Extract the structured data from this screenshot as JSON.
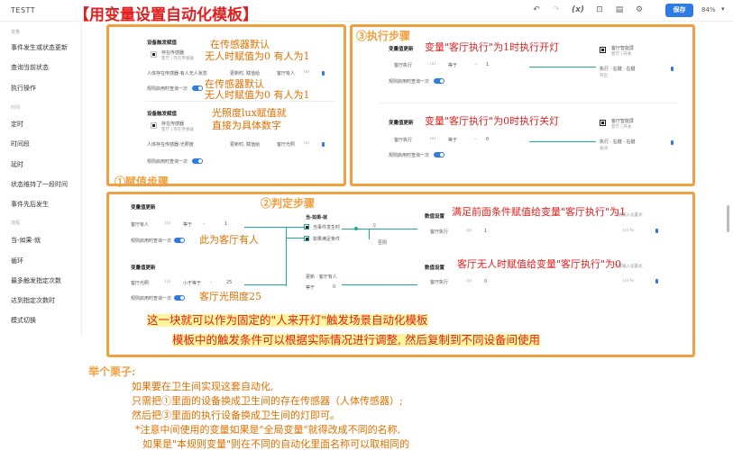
{
  "app": {
    "title": "TESTT",
    "main_title": "【用变量设置自动化模板】"
  },
  "toolbar": {
    "save_label": "保存",
    "zoom": "84%",
    "fx_label": "(x)"
  },
  "sidebar": {
    "sections": [
      {
        "label": "变量"
      },
      {
        "label": "时间"
      },
      {
        "label": "流程"
      }
    ],
    "items": [
      {
        "label": "事件发生或状态更新"
      },
      {
        "label": "查询当前状态"
      },
      {
        "label": "执行操作"
      },
      {
        "label": "定时"
      },
      {
        "label": "时间段"
      },
      {
        "label": "延时"
      },
      {
        "label": "状态维持了一段时间"
      },
      {
        "label": "事件先后发生"
      },
      {
        "label": "当-如果-就"
      },
      {
        "label": "循环"
      },
      {
        "label": "最多触发指定次数"
      },
      {
        "label": "达到指定次数时"
      },
      {
        "label": "模式切换"
      }
    ]
  },
  "panel1": {
    "node1_title": "设备触发赋值",
    "node1_sub1": "存在传感器",
    "node1_sub2": "客厅 | 存在传感器",
    "node1_row": "人体存在传感器-有人无人状态",
    "node1_op": "更新时, 赋值给",
    "node1_var": "客厅有人",
    "node1_fx": "(x)",
    "node1_toggle_label": "规则启用时查询一次",
    "node2_title": "设备触发赋值",
    "node2_sub1": "存在传感器",
    "node2_sub2": "客厅 | 存在传感器",
    "node2_row": "人体存在传感器-光照度",
    "node2_op": "更新时, 赋值给",
    "node2_var": "客厅光照",
    "node2_fx": "(x)",
    "node2_toggle_label": "规则启用时查询一次",
    "ann1": "在传感器默认",
    "ann2": "无人时赋值为0 有人为1",
    "ann3": "在传感器默认",
    "ann4": "无人时赋值为0 有人为1",
    "ann5": "光照度lux赋值就",
    "ann6": "直接为具体数字",
    "step": "①赋值步骤"
  },
  "panel2": {
    "step": "③执行步骤",
    "n1_title": "变量值更新",
    "n1_var": "客厅执行",
    "n1_fx": "(x)",
    "n1_op": "等于",
    "n1_dash": "-",
    "n1_val": "1",
    "n1_toggle_label": "规则启用时查询一次",
    "n1_dev_title": "客厅智能屏",
    "n1_dev_sub": "客厅 | 开关",
    "n1_action": "执行 · 右键 · 右键",
    "n1_action_sub": "开启",
    "n2_title": "变量值更新",
    "n2_var": "客厅执行",
    "n2_fx": "(x)",
    "n2_op": "等于",
    "n2_dash": "-",
    "n2_val": "0",
    "n2_toggle_label": "规则启用时查询一次",
    "n2_dev_title": "客厅智能屏",
    "n2_dev_sub": "客厅 | 开关",
    "n2_action": "执行 · 右键 · 右键",
    "n2_action_sub": "关闭",
    "ann1": "变量\"客厅执行\"为1时执行开灯",
    "ann2": "变量\"客厅执行\"为0时执行关灯"
  },
  "panel3": {
    "step": "②判定步骤",
    "n1_title": "变量值更新",
    "n1_var": "客厅有人",
    "n1_fx": "(x)",
    "n1_op": "等于",
    "n1_dash": "-",
    "n1_val": "1",
    "n1_toggle_label": "规则启用时查询一次",
    "n2_title": "变量值更新",
    "n2_var": "客厅光照",
    "n2_fx": "(x)",
    "n2_op": "小于等于",
    "n2_dash": "-",
    "n2_val": "25",
    "n2_toggle_label": "规则启用时查询一次",
    "logic_title": "当-如果-就",
    "logic_when": "当事件发生时",
    "logic_if": "如果满足条件",
    "logic_yes": "是",
    "logic_no": "否则",
    "upd_title": "更新 · 客厅有人",
    "upd_op": "等于",
    "upd_val": "0",
    "set1_title": "数值设置",
    "set1_placeholder": "功能输入设置式",
    "set1_var": "客厅执行",
    "set1_fx": "(x)",
    "set1_val": "1",
    "set1_fx2": "(x) fx",
    "set2_title": "数值设置",
    "set2_placeholder": "功能输入设置式",
    "set2_var": "客厅执行",
    "set2_fx": "(x)",
    "set2_val": "0",
    "set2_fx2": "(x) fx",
    "ann1": "满足前面条件赋值给变量\"客厅执行\"为1",
    "ann2": "客厅无人时赋值给变量\"客厅执行\"为0",
    "ann3": "此为客厅有人",
    "ann4": "客厅光照度25",
    "big1": "这一块就可以作为固定的\"人来开灯\"触发场景自动化模板",
    "big2": "模板中的触发条件可以根据实际情况进行调整, 然后复制到不同设备间使用"
  },
  "notes": {
    "title": "举个栗子:",
    "lines": [
      "如果要在卫生间实现这套自动化,",
      "只需把①里面的设备换成卫生间的存在传感器（人体传感器）;",
      "然后把③里面的执行设备换成卫生间的灯即可。",
      "*注意中间使用的变量如果是\"全局变量\"就得改成不同的名称,",
      "如果是\"本规则变量\"则在不同的自动化里面名称可以取相同的"
    ]
  },
  "colors": {
    "accent": "#2f7be5",
    "annotation": "#e07000",
    "title_red": "#e02020",
    "panel_border": "#f0a040",
    "flow_line": "#1fa89a"
  }
}
